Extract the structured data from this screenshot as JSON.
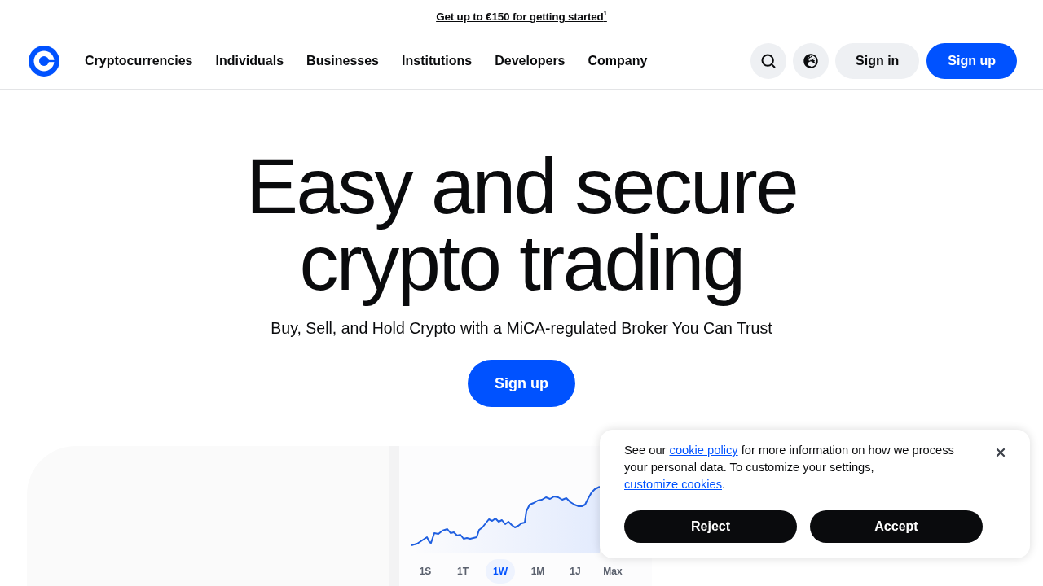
{
  "promo_banner": {
    "link": "Get up to €150 for getting started$^{1}$"
  },
  "nav": {
    "links": [
      "Cryptocurrencies",
      "Individuals",
      "Businesses",
      "Institutions",
      "Developers",
      "Company"
    ],
    "sign_in": "Sign in",
    "sign_up": "Sign up"
  },
  "hero": {
    "title": "Easy and secure crypto trading",
    "subtitle": "Buy, Sell, and Hold Crypto with a MiCA-regulated Broker You Can Trust",
    "button": "Sign up"
  },
  "price_chart": {
    "ranges": [
      {
        "label": "1S",
        "selected": false
      },
      {
        "label": "1T",
        "selected": false
      },
      {
        "label": "1W",
        "selected": true
      },
      {
        "label": "1M",
        "selected": false
      },
      {
        "label": "1J",
        "selected": false
      },
      {
        "label": "Max",
        "selected": false
      }
    ]
  },
  "cookie_notice": {
    "text_before": "See our ",
    "policy_link": "cookie policy",
    "text_middle": " for more information on how we process your personal data. To customize your settings, ",
    "customize_link": "customize cookies",
    "text_after": ".",
    "buttons": [
      "Reject",
      "Accept"
    ]
  }
}
